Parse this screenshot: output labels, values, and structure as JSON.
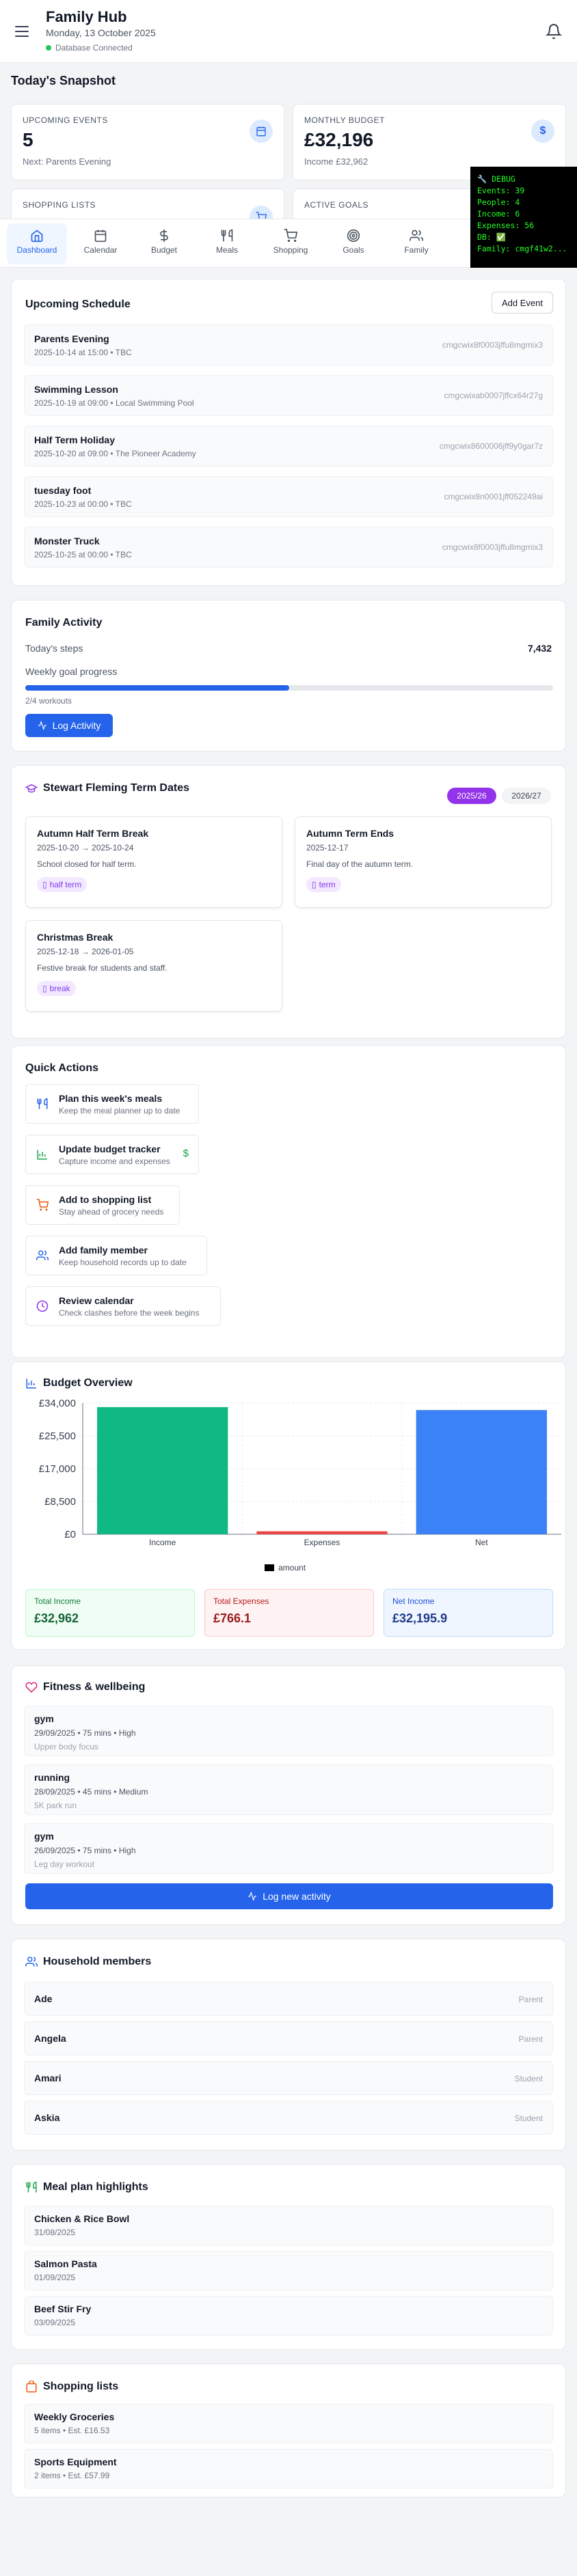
{
  "app": {
    "title": "Family Hub",
    "date": "Monday, 13 October 2025",
    "db_status": "Database Connected"
  },
  "snapshot": {
    "heading": "Today's Snapshot",
    "cards": [
      {
        "label": "Upcoming Events",
        "value": "5",
        "sub": "Next: Parents Evening",
        "icon": "calendar-icon"
      },
      {
        "label": "Monthly Budget",
        "value": "£32,196",
        "sub": "Income £32,962",
        "icon": "dollar-icon"
      },
      {
        "label": "Shopping Lists",
        "value": "",
        "sub": "",
        "icon": "cart-icon"
      },
      {
        "label": "Active Goals",
        "value": "",
        "sub": "",
        "icon": "target-icon"
      }
    ]
  },
  "debug": {
    "lines": [
      "🔧 DEBUG",
      "Events: 39",
      "People: 4",
      "Income: 6",
      "Expenses: 56",
      "DB: ✅",
      "Family: cmgf41w2..."
    ]
  },
  "nav": {
    "items": [
      {
        "label": "Dashboard",
        "icon": "home-icon",
        "active": true
      },
      {
        "label": "Calendar",
        "icon": "calendar-icon"
      },
      {
        "label": "Budget",
        "icon": "dollar-icon"
      },
      {
        "label": "Meals",
        "icon": "utensils-icon"
      },
      {
        "label": "Shopping",
        "icon": "cart-icon"
      },
      {
        "label": "Goals",
        "icon": "target-icon"
      },
      {
        "label": "Family",
        "icon": "users-icon"
      }
    ]
  },
  "schedule": {
    "title": "Upcoming Schedule",
    "add_label": "Add Event",
    "events": [
      {
        "title": "Parents Evening",
        "meta": "2025-10-14 at 15:00 • TBC",
        "id": "cmgcwix8f0003jffu8mgmix3"
      },
      {
        "title": "Swimming Lesson",
        "meta": "2025-10-19 at 09:00 • Local Swimming Pool",
        "id": "cmgcwixab0007jffcx64r27g"
      },
      {
        "title": "Half Term Holiday",
        "meta": "2025-10-20 at 09:00 • The Pioneer Academy",
        "id": "cmgcwix8600006jff9y0gar7z"
      },
      {
        "title": "tuesday foot",
        "meta": "2025-10-23 at 00:00 • TBC",
        "id": "cmgcwix8n0001jff052249ai"
      },
      {
        "title": "Monster Truck",
        "meta": "2025-10-25 at 00:00 • TBC",
        "id": "cmgcwix8f0003jffu8mgmix3"
      }
    ]
  },
  "activity": {
    "title": "Family Activity",
    "steps_label": "Today's steps",
    "steps_value": "7,432",
    "goal_label": "Weekly goal progress",
    "goal_progress": 0.5,
    "goal_text": "2/4 workouts",
    "log_label": "Log Activity"
  },
  "terms": {
    "title": "Stewart Fleming Term Dates",
    "years": [
      {
        "label": "2025/26",
        "active": true
      },
      {
        "label": "2026/27",
        "active": false
      }
    ],
    "cards": [
      {
        "title": "Autumn Half Term Break",
        "dates": "2025-10-20 → 2025-10-24",
        "desc": "School closed for half term.",
        "tag": "half term"
      },
      {
        "title": "Autumn Term Ends",
        "dates": "2025-12-17",
        "desc": "Final day of the autumn term.",
        "tag": "term"
      },
      {
        "title": "Christmas Break",
        "dates": "2025-12-18 → 2026-01-05",
        "desc": "Festive break for students and staff.",
        "tag": "break"
      }
    ]
  },
  "quick_actions": {
    "title": "Quick Actions",
    "items": [
      {
        "title": "Plan this week's meals",
        "sub": "Keep the meal planner up to date",
        "icon": "utensils-icon",
        "color": "#2563eb"
      },
      {
        "title": "Update budget tracker",
        "sub": "Capture income and expenses",
        "icon": "chart-icon",
        "color": "#16a34a"
      },
      {
        "title": "Add to shopping list",
        "sub": "Stay ahead of grocery needs",
        "icon": "cart-icon",
        "color": "#ea580c"
      },
      {
        "title": "Add family member",
        "sub": "Keep household records up to date",
        "icon": "users-icon",
        "color": "#2563eb"
      },
      {
        "title": "Review calendar",
        "sub": "Check clashes before the week begins",
        "icon": "clock-icon",
        "color": "#9333ea"
      }
    ]
  },
  "budget": {
    "title": "Budget Overview",
    "legend": "amount",
    "total_income_label": "Total Income",
    "total_income": "£32,962",
    "total_expenses_label": "Total Expenses",
    "total_expenses": "£766.1",
    "net_income_label": "Net Income",
    "net_income": "£32,195.9"
  },
  "chart_data": {
    "type": "bar",
    "categories": [
      "Income",
      "Expenses",
      "Net"
    ],
    "series": [
      {
        "name": "amount",
        "values": [
          32962,
          766.1,
          32195.9
        ]
      }
    ],
    "colors": [
      "#10b981",
      "#ef4444",
      "#3b82f6"
    ],
    "yticks": [
      "£34,000",
      "£25,500",
      "£17,000",
      "£8,500",
      "£0"
    ],
    "ylim": [
      0,
      34000
    ],
    "grid": true,
    "legend_position": "bottom"
  },
  "fitness": {
    "title": "Fitness & wellbeing",
    "items": [
      {
        "title": "gym",
        "meta": "29/09/2025 • 75 mins • High",
        "note": "Upper body focus"
      },
      {
        "title": "running",
        "meta": "28/09/2025 • 45 mins • Medium",
        "note": "5K park run"
      },
      {
        "title": "gym",
        "meta": "26/09/2025 • 75 mins • High",
        "note": "Leg day workout"
      }
    ],
    "log_label": "Log new activity"
  },
  "household": {
    "title": "Household members",
    "members": [
      {
        "name": "Ade",
        "role": "Parent"
      },
      {
        "name": "Angela",
        "role": "Parent"
      },
      {
        "name": "Amari",
        "role": "Student"
      },
      {
        "name": "Askia",
        "role": "Student"
      }
    ]
  },
  "meals": {
    "title": "Meal plan highlights",
    "items": [
      {
        "name": "Chicken & Rice Bowl",
        "date": "31/08/2025"
      },
      {
        "name": "Salmon Pasta",
        "date": "01/09/2025"
      },
      {
        "name": "Beef Stir Fry",
        "date": "03/09/2025"
      }
    ]
  },
  "shopping": {
    "title": "Shopping lists",
    "lists": [
      {
        "name": "Weekly Groceries",
        "meta": "5 items • Est. £16.53"
      },
      {
        "name": "Sports Equipment",
        "meta": "2 items • Est. £57.99"
      }
    ]
  }
}
